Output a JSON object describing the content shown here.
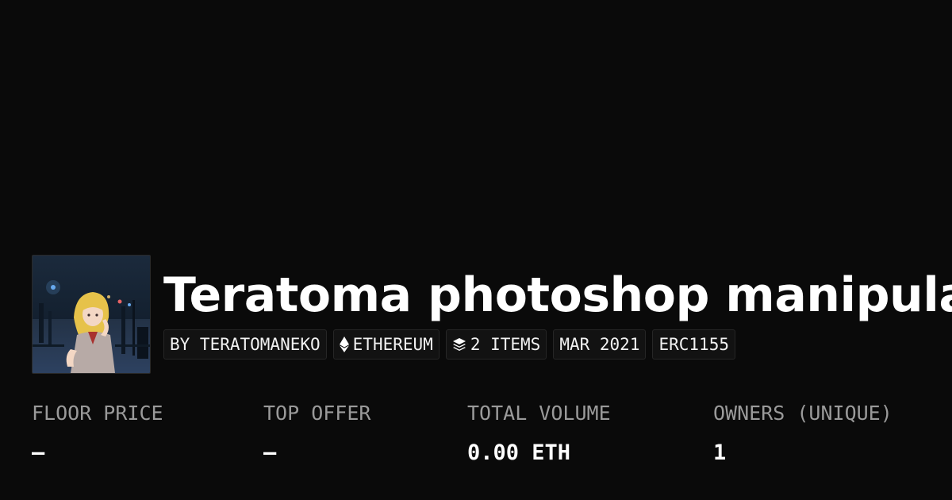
{
  "collection": {
    "title": "Teratoma photoshop manipulations",
    "tags": {
      "creator": "BY TERATOMANEKO",
      "chain": "ETHEREUM",
      "items": "2 ITEMS",
      "date": "MAR 2021",
      "standard": "ERC1155"
    },
    "icons": {
      "chain": "ethereum-icon",
      "items": "layers-icon"
    }
  },
  "stats": {
    "floor_price": {
      "label": "FLOOR PRICE",
      "value": "–"
    },
    "top_offer": {
      "label": "TOP OFFER",
      "value": "–"
    },
    "total_volume": {
      "label": "TOTAL VOLUME",
      "value": "0.00 ETH"
    },
    "owners": {
      "label": "OWNERS (UNIQUE)",
      "value": "1"
    }
  },
  "colors": {
    "background": "#0a0a0a",
    "text": "#ffffff",
    "muted": "#9a9a9a",
    "tag_bg": "#121212",
    "tag_border": "#262626"
  }
}
